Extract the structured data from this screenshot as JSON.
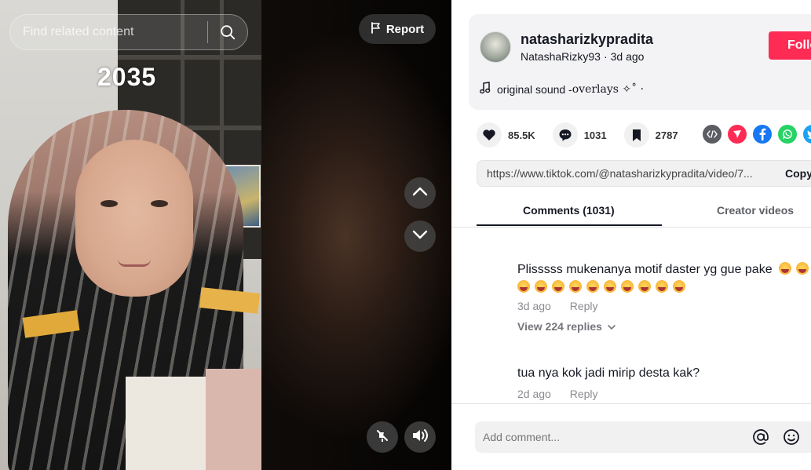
{
  "video": {
    "overlay_text": "2035",
    "search_placeholder": "Find related content",
    "report_label": "Report"
  },
  "author": {
    "username": "natasharizkypradita",
    "display_name": "NatashaRizky93",
    "separator": "·",
    "posted": "3d ago",
    "follow_label": "Follo",
    "sound_prefix": "original sound - ",
    "sound_name": "overlays ✧˚ ·"
  },
  "stats": {
    "likes": "85.5K",
    "comments": "1031",
    "saves": "2787"
  },
  "link": {
    "url": "https://www.tiktok.com/@natasharizkypradita/video/7...",
    "copy_label": "Copy"
  },
  "tabs": [
    {
      "label": "Comments (1031)",
      "active": true
    },
    {
      "label": "Creator videos",
      "active": false
    }
  ],
  "comments": [
    {
      "text": "Plisssss mukenanya motif daster yg gue pake",
      "emoji_count_line1": 2,
      "emoji_count_line2": 10,
      "time": "3d ago",
      "reply_label": "Reply",
      "view_replies": "View 224 replies"
    },
    {
      "text": "tua nya kok jadi mirip desta kak?",
      "time": "2d ago",
      "reply_label": "Reply"
    }
  ],
  "comment_input": {
    "placeholder": "Add comment..."
  },
  "colors": {
    "follow": "#fe2c55",
    "text_primary": "#161823",
    "text_secondary": "#8a8b91",
    "panel_bg": "#f3f3f5"
  },
  "icons": [
    "search-icon",
    "flag-icon",
    "chevron-up-icon",
    "chevron-down-icon",
    "mute-icon",
    "volume-icon",
    "music-note-icon",
    "heart-icon",
    "comment-icon",
    "bookmark-icon",
    "embed-icon",
    "send-icon",
    "facebook-icon",
    "whatsapp-icon",
    "twitter-icon",
    "at-icon",
    "emoji-icon"
  ]
}
